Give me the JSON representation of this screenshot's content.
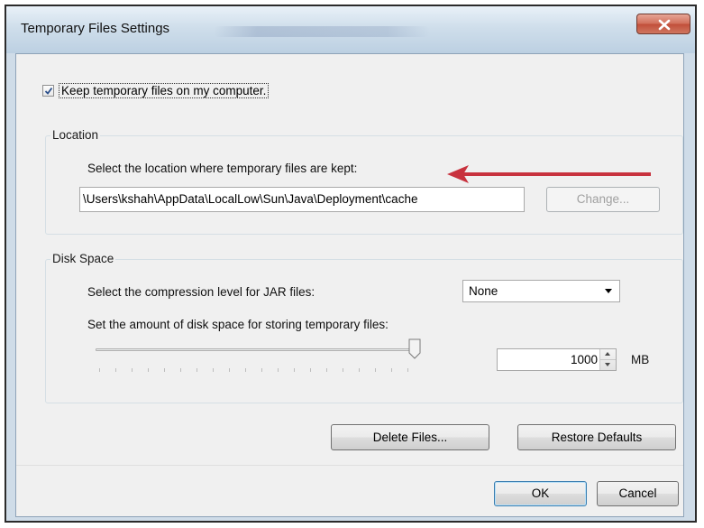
{
  "window": {
    "title": "Temporary Files Settings",
    "close_icon": "close-icon"
  },
  "keep_files": {
    "label": "Keep temporary files on my computer.",
    "checked": true
  },
  "location": {
    "group_label": "Location",
    "prompt": "Select the location where temporary files are kept:",
    "path": "\\Users\\kshah\\AppData\\LocalLow\\Sun\\Java\\Deployment\\cache",
    "change_button": "Change..."
  },
  "disk_space": {
    "group_label": "Disk Space",
    "compression_prompt": "Select the compression level for JAR files:",
    "compression_value": "None",
    "space_prompt": "Set the amount of disk space for storing temporary files:",
    "slider_level": 1.0,
    "amount": "1000",
    "unit": "MB"
  },
  "actions": {
    "delete_files": "Delete Files...",
    "restore_defaults": "Restore Defaults"
  },
  "footer": {
    "ok": "OK",
    "cancel": "Cancel"
  },
  "colors": {
    "annotation_arrow": "#c8323e",
    "close_button": "#c9583f"
  }
}
